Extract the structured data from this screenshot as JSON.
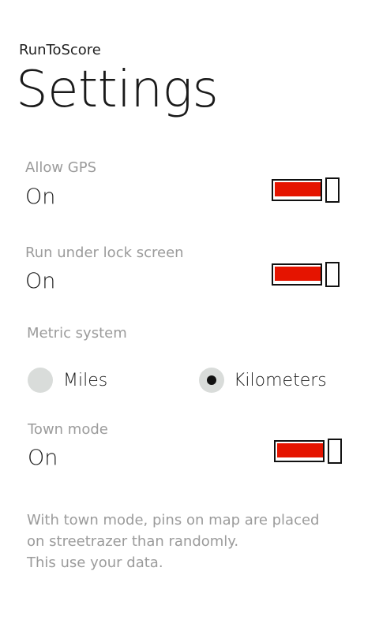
{
  "app": {
    "title": "RunToScore"
  },
  "page": {
    "title": "Settings"
  },
  "settings": {
    "allow_gps": {
      "label": "Allow GPS",
      "value": "On",
      "enabled": true
    },
    "lock_screen": {
      "label": "Run under lock screen",
      "value": "On",
      "enabled": true
    },
    "metric": {
      "label": "Metric system",
      "options": [
        {
          "label": "Miles",
          "selected": false
        },
        {
          "label": "Kilometers",
          "selected": true
        }
      ]
    },
    "town_mode": {
      "label": "Town mode",
      "value": "On",
      "enabled": true
    }
  },
  "note": {
    "lines": [
      "With town mode, pins on map are placed",
      "on streetrazer than randomly.",
      "This use your data."
    ]
  },
  "colors": {
    "accent": "#e51400",
    "radio_bg": "#d9dcda",
    "label_gray": "#9b9b9b"
  }
}
